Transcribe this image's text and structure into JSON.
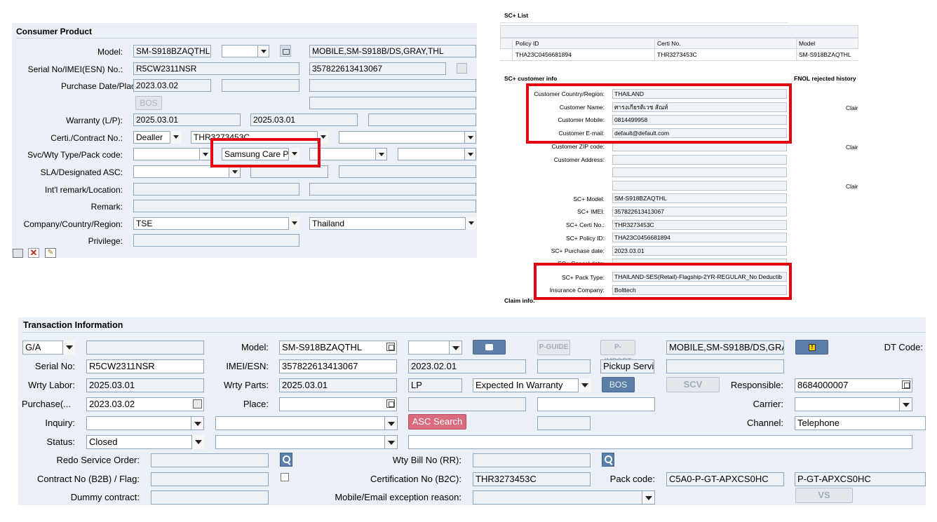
{
  "consumer": {
    "title": "Consumer Product",
    "labels": {
      "model": "Model:",
      "serial": "Serial No/IMEI(ESN) No.:",
      "purchase": "Purchase Date/Place:",
      "warranty": "Warranty (L/P):",
      "certi": "Certi./Contract No.:",
      "svc": "Svc/Wty Type/Pack code:",
      "sla": "SLA/Designated ASC:",
      "intl": "Int'l remark/Location:",
      "remark": "Remark:",
      "company": "Company/Country/Region:",
      "privilege": "Privilege:"
    },
    "model": "SM-S918BZAQTHL",
    "model_desc": "MOBILE,SM-S918B/DS,GRAY,THL",
    "serial": "R5CW2311NSR",
    "imei": "357822613413067",
    "purchase_date": "2023.03.02",
    "bos_label": "BOS",
    "warranty_labor": "2025.03.01",
    "warranty_parts": "2025.03.01",
    "certi_type": "Dealler",
    "certi_no": "THR3273453C",
    "pack_code": "Samsung Care Pl",
    "company": "TSE",
    "country": "Thailand"
  },
  "sc_list": {
    "title": "SC+ List",
    "columns": [
      "Policy ID",
      "Certi No.",
      "Model"
    ],
    "row": [
      "THA23C0456681894",
      "THR3273453C",
      "SM-S918BZAQTHL"
    ]
  },
  "sc_info": {
    "title": "SC+ customer info",
    "fnol_title": "FNOL rejected history",
    "claim_word": "Clair",
    "claim_info": "Claim info.",
    "fields": [
      {
        "label": "Customer Country/Region:",
        "value": "THAILAND"
      },
      {
        "label": "Customer Name:",
        "value": "ศารงเกียรติเวช สัณห์"
      },
      {
        "label": "Customer Mobile:",
        "value": "0814499958"
      },
      {
        "label": "Customer E-mail:",
        "value": "default@default.com"
      },
      {
        "label": "Customer ZIP code:",
        "value": ""
      },
      {
        "label": "Customer Address:",
        "value": ""
      },
      {
        "label": "",
        "value": ""
      },
      {
        "label": "",
        "value": ""
      },
      {
        "label": "SC+ Model:",
        "value": "SM-S918BZAQTHL"
      },
      {
        "label": "SC+ IMEI:",
        "value": "357822613413067"
      },
      {
        "label": "SC+ Certi No.:",
        "value": "THR3273453C"
      },
      {
        "label": "SC+ Policy ID:",
        "value": "THA23C0456681894"
      },
      {
        "label": "SC+ Purchase date:",
        "value": "2023.03.01"
      },
      {
        "label": "SC+ Cancel date:",
        "value": ""
      },
      {
        "label": "SC+ Pack Type:",
        "value": "THAILAND-SES(Retail)-Flagship-2YR-REGULAR_No Deductib"
      },
      {
        "label": "Insurance Company:",
        "value": "Bolttech"
      }
    ]
  },
  "transaction": {
    "title": "Transaction Information",
    "ga": "G/A",
    "labels": {
      "model": "Model:",
      "dt_code": "DT Code:",
      "serial": "Serial No:",
      "imei": "IMEI/ESN:",
      "wrty_labor": "Wrty Labor:",
      "wrty_parts": "Wrty Parts:",
      "responsible": "Responsible:",
      "purchase": "Purchase(...",
      "place": "Place:",
      "carrier": "Carrier:",
      "inquiry": "Inquiry:",
      "channel": "Channel:",
      "status": "Status:",
      "redo": "Redo Service Order:",
      "wty_bill": "Wty Bill No (RR):",
      "contract": "Contract No (B2B) / Flag:",
      "cert_b2c": "Certification No (B2C):",
      "pack_code": "Pack code:",
      "dummy": "Dummy contract:",
      "mobile_exc": "Mobile/Email exception reason:"
    },
    "model": "SM-S918BZAQTHL",
    "model_desc": "MOBILE,SM-S918B/DS,GRA",
    "serial": "R5CW2311NSR",
    "imei": "357822613413067",
    "date1": "2023.02.01",
    "pickup": "Pickup Servi",
    "wrty_labor": "2025.03.01",
    "wrty_parts": "2025.03.01",
    "lp": "LP",
    "expected": "Expected In Warranty",
    "responsible": "8684000007",
    "purchase": "2023.03.02",
    "channel": "Telephone",
    "status": "Closed",
    "cert_b2c": "THR3273453C",
    "pack_code": "C5A0-P-GT-APXCS0HC",
    "pack_code2": "P-GT-APXCS0HC",
    "buttons": {
      "pguide": "P-GUIDE",
      "pimport": "P-IMPORT",
      "bos": "BOS",
      "scv": "SCV",
      "asc": "ASC Search",
      "vs": "VS"
    }
  }
}
